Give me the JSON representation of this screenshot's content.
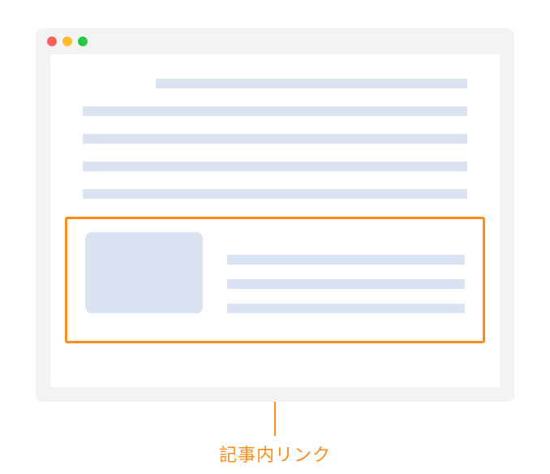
{
  "colors": {
    "accent": "#ff8c1a",
    "placeholder": "#dbe2f2",
    "window_bg": "#f3f3f3",
    "traffic_red": "#ff5f57",
    "traffic_yellow": "#ffbd2e",
    "traffic_green": "#28c940"
  },
  "annotation": {
    "label": "記事内リンク"
  }
}
